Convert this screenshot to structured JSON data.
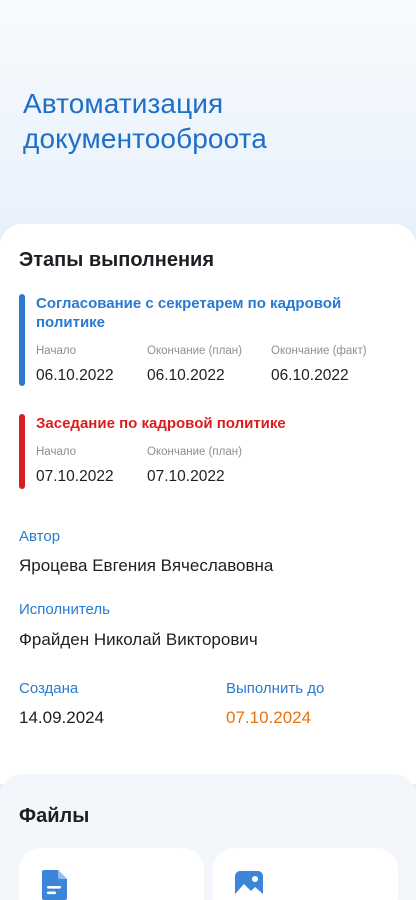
{
  "task": {
    "title": "Автоматизация документооброота"
  },
  "stages_section": {
    "title": "Этапы выполнения"
  },
  "stages": [
    {
      "name": "Согласование с секретарем по кадровой политике",
      "color": "#2a7ad0",
      "start_label": "Начало",
      "start": "06.10.2022",
      "end_plan_label": "Окончание (план)",
      "end_plan": "06.10.2022",
      "end_fact_label": "Окончание (факт)",
      "end_fact": "06.10.2022"
    },
    {
      "name": "Заседание по кадровой политике",
      "color": "#d81f1f",
      "start_label": "Начало",
      "start": "07.10.2022",
      "end_plan_label": "Окончание (план)",
      "end_plan": "07.10.2022"
    }
  ],
  "author": {
    "label": "Автор",
    "value": "Яроцева Евгения Вячеславовна"
  },
  "executor": {
    "label": "Исполнитель",
    "value": "Фрайден Николай Викторович"
  },
  "created": {
    "label": "Создана",
    "value": "14.09.2024"
  },
  "due": {
    "label": "Выполнить до",
    "value": "07.10.2024",
    "color": "#e8720c"
  },
  "files": {
    "title": "Файлы",
    "items": [
      {
        "icon": "document-icon"
      },
      {
        "icon": "image-icon"
      }
    ]
  }
}
